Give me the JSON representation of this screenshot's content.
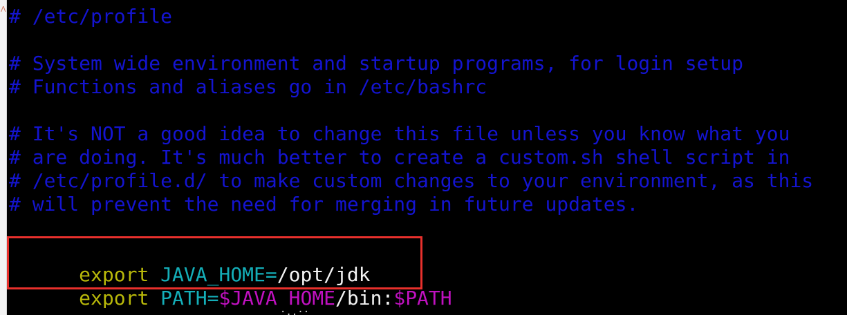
{
  "editor": {
    "left_mark": "Λ",
    "lines": [
      "# /etc/profile",
      "",
      "# System wide environment and startup programs, for login setup",
      "# Functions and aliases go in /etc/bashrc",
      "",
      "# It's NOT a good idea to change this file unless you know what you",
      "# are doing. It's much better to create a custom.sh shell script in",
      "# /etc/profile.d/ to make custom changes to your environment, as this",
      "# will prevent the need for merging in future updates."
    ],
    "exports": [
      {
        "keyword": "export",
        "variable": "JAVA_HOME",
        "operator": "=",
        "value": "/opt/jdk"
      },
      {
        "keyword": "export",
        "variable": "PATH",
        "operator": "=",
        "ref1": "$JAVA_HOME",
        "middle": "/bin:",
        "ref2": "$PATH"
      }
    ],
    "bottom_fragment": "·..··"
  },
  "colors": {
    "background": "#000000",
    "comment": "#1414d0",
    "keyword": "#b8b80a",
    "variable": "#14aeb8",
    "reference": "#c011c0",
    "text": "#f2f2f2",
    "highlight_border": "#e8302c"
  }
}
